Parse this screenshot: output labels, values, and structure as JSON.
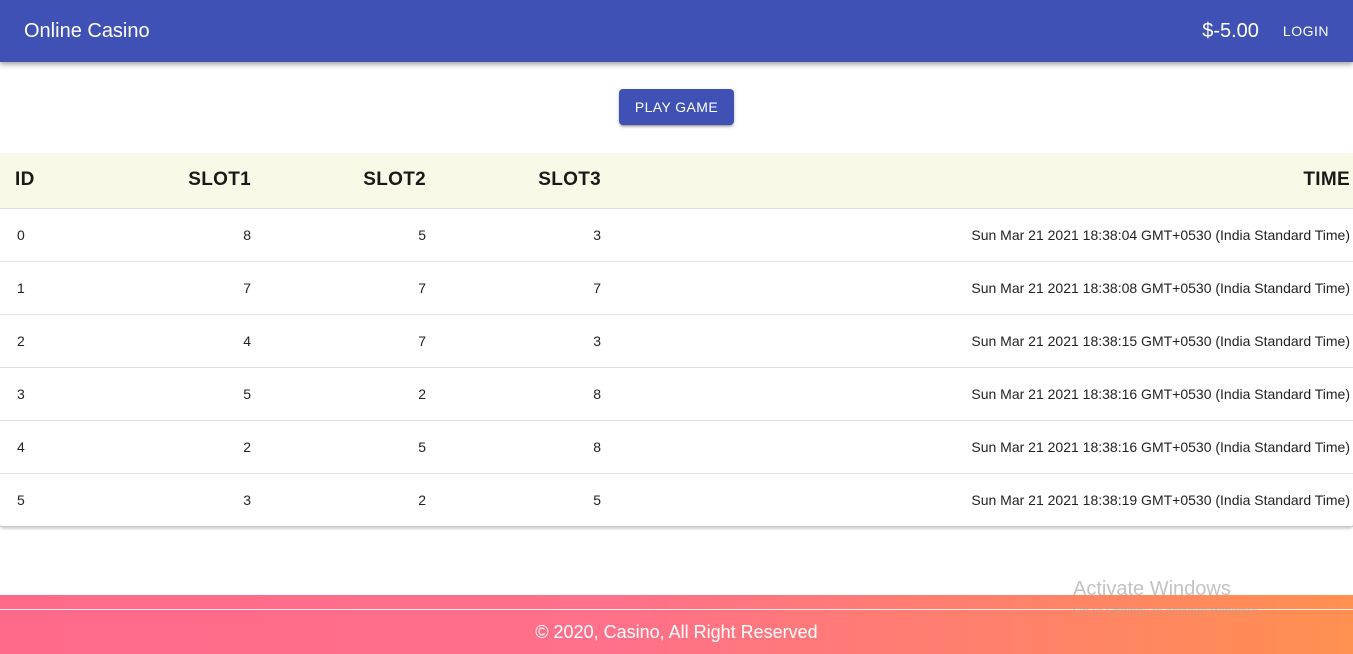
{
  "appbar": {
    "title": "Online Casino",
    "balance": "$-5.00",
    "login_label": "LOGIN",
    "color": "#3f51b5"
  },
  "main": {
    "play_label": "PLAY GAME"
  },
  "table": {
    "headers": [
      "ID",
      "SLOT1",
      "SLOT2",
      "SLOT3",
      "TIME"
    ],
    "rows": [
      [
        "0",
        "8",
        "5",
        "3",
        "Sun Mar 21 2021 18:38:04 GMT+0530 (India Standard Time)"
      ],
      [
        "1",
        "7",
        "7",
        "7",
        "Sun Mar 21 2021 18:38:08 GMT+0530 (India Standard Time)"
      ],
      [
        "2",
        "4",
        "7",
        "3",
        "Sun Mar 21 2021 18:38:15 GMT+0530 (India Standard Time)"
      ],
      [
        "3",
        "5",
        "2",
        "8",
        "Sun Mar 21 2021 18:38:16 GMT+0530 (India Standard Time)"
      ],
      [
        "4",
        "2",
        "5",
        "8",
        "Sun Mar 21 2021 18:38:16 GMT+0530 (India Standard Time)"
      ],
      [
        "5",
        "3",
        "2",
        "5",
        "Sun Mar 21 2021 18:38:19 GMT+0530 (India Standard Time)"
      ]
    ],
    "header_bg": "#f8f9e6"
  },
  "footer": {
    "copyright": "© 2020, Casino, All Right Reserved",
    "gradient": [
      "#ff6a8b",
      "#ff9050"
    ]
  },
  "watermark": {
    "title": "Activate Windows",
    "subtitle": "Go to Settings to activate Windows."
  }
}
